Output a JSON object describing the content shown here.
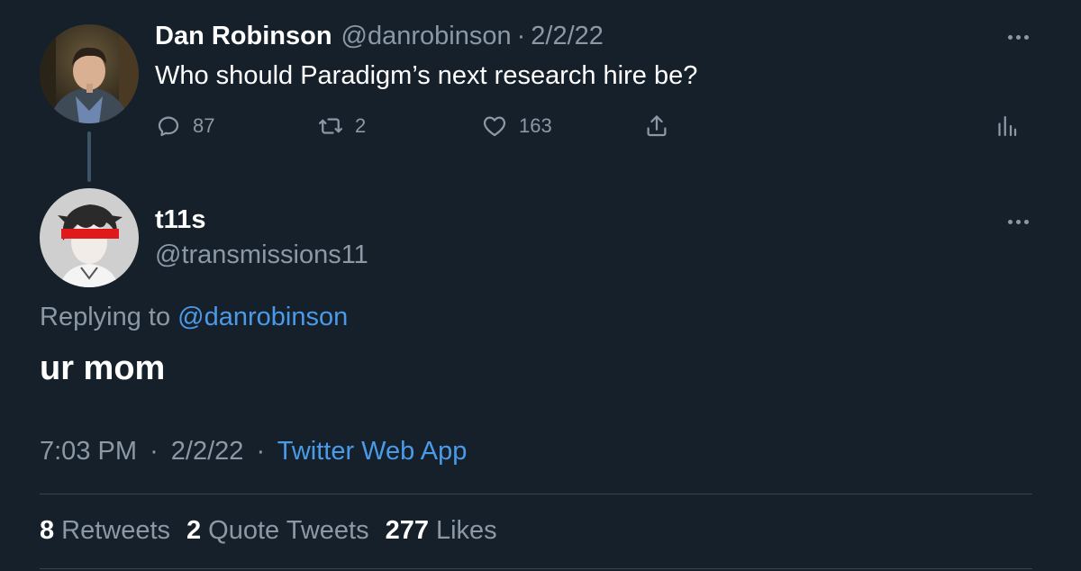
{
  "parent_tweet": {
    "display_name": "Dan Robinson",
    "handle": "@danrobinson",
    "separator": "·",
    "date": "2/2/22",
    "text": "Who should Paradigm’s next research hire be?",
    "replies": "87",
    "retweets": "2",
    "likes": "163"
  },
  "reply_tweet": {
    "display_name": "t11s",
    "handle": "@transmissions11",
    "replying_prefix": "Replying to",
    "replying_to": "@danrobinson",
    "text": "ur mom",
    "time": "7:03 PM",
    "separator": "·",
    "date": "2/2/22",
    "source": "Twitter Web App"
  },
  "engagement": {
    "retweets_count": "8",
    "retweets_label": "Retweets",
    "quotes_count": "2",
    "quotes_label": "Quote Tweets",
    "likes_count": "277",
    "likes_label": "Likes"
  },
  "colors": {
    "background": "#15202b",
    "text_primary": "#ffffff",
    "text_muted": "#8b98a5",
    "link": "#1d9bf0",
    "divider": "#38444d",
    "redaction_bar": "#e0191b"
  },
  "icons": [
    "reply-icon",
    "retweet-icon",
    "like-icon",
    "share-icon",
    "analytics-icon",
    "more-icon"
  ]
}
